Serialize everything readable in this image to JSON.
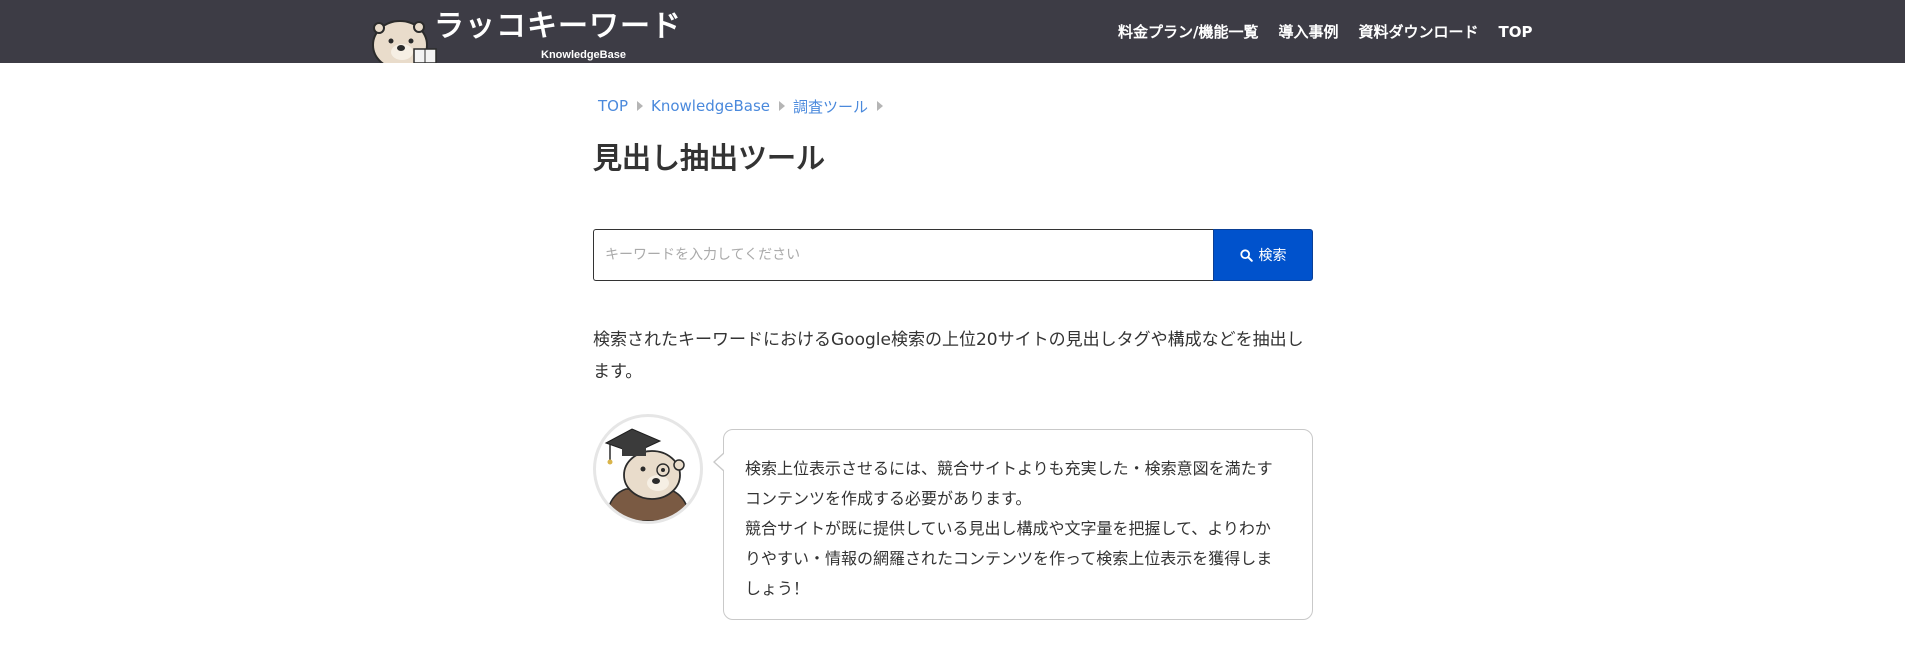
{
  "header": {
    "logo": {
      "title": "ラッコキーワード",
      "subtitle": "KnowledgeBase",
      "mascot_icon": "sea-otter-mascot-icon"
    },
    "nav": [
      {
        "label": "料金プラン/機能一覧"
      },
      {
        "label": "導入事例"
      },
      {
        "label": "資料ダウンロード"
      },
      {
        "label": "TOP"
      }
    ],
    "background_color": "#3d3c45"
  },
  "breadcrumb": [
    {
      "label": "TOP"
    },
    {
      "label": "KnowledgeBase"
    },
    {
      "label": "調査ツール"
    }
  ],
  "page_title": "見出し抽出ツール",
  "search": {
    "placeholder": "キーワードを入力してください",
    "value": "",
    "button_label": "検索",
    "button_icon": "search-icon",
    "button_color": "#0052cc"
  },
  "description": "検索されたキーワードにおけるGoogle検索の上位20サイトの見出しタグや構成などを抽出します。",
  "speech": {
    "avatar_icon": "sea-otter-graduate-avatar-icon",
    "lines": [
      "検索上位表示させるには、競合サイトよりも充実した・検索意図を満たす",
      "コンテンツを作成する必要があります。",
      "競合サイトが既に提供している見出し構成や文字量を把握して、よりわか",
      "りやすい・情報の網羅されたコンテンツを作って検索上位表示を獲得しま",
      "しょう！"
    ]
  }
}
